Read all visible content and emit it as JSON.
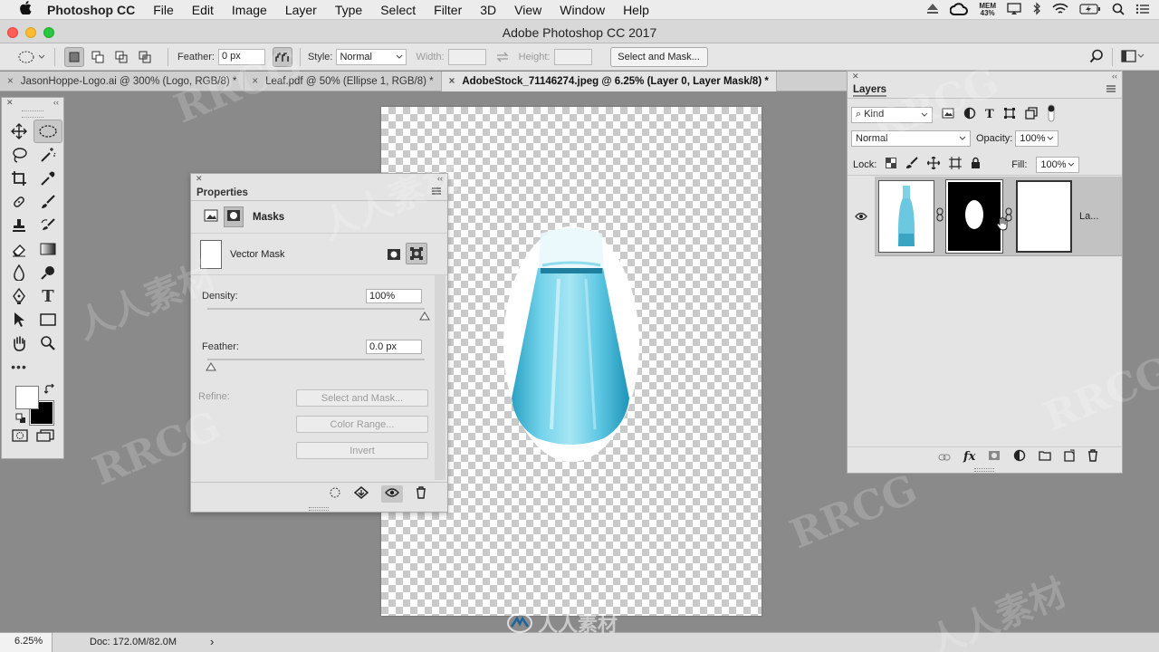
{
  "menubar": {
    "app_name": "Photoshop CC",
    "items": [
      "File",
      "Edit",
      "Image",
      "Layer",
      "Type",
      "Select",
      "Filter",
      "3D",
      "View",
      "Window",
      "Help"
    ],
    "mem_label": "MEM",
    "mem_value": "43%"
  },
  "window": {
    "title": "Adobe Photoshop CC 2017"
  },
  "options": {
    "feather_label": "Feather:",
    "feather_value": "0 px",
    "style_label": "Style:",
    "style_value": "Normal",
    "width_label": "Width:",
    "height_label": "Height:",
    "select_mask_button": "Select and Mask..."
  },
  "tabs": [
    {
      "label": "JasonHoppe-Logo.ai @ 300% (Logo, RGB/8) *"
    },
    {
      "label": "Leaf.pdf @ 50% (Ellipse 1, RGB/8) *"
    },
    {
      "label": "AdobeStock_71146274.jpeg @ 6.25% (Layer 0, Layer Mask/8) *"
    }
  ],
  "properties": {
    "panel_title": "Properties",
    "section": "Masks",
    "mask_type": "Vector Mask",
    "density_label": "Density:",
    "density_value": "100%",
    "density_fraction": 1.0,
    "feather_label": "Feather:",
    "feather_value": "0.0 px",
    "feather_fraction": 0.0,
    "refine_label": "Refine:",
    "buttons": {
      "select_mask": "Select and Mask...",
      "color_range": "Color Range...",
      "invert": "Invert"
    }
  },
  "layers": {
    "panel_title": "Layers",
    "filter_value": "Kind",
    "blend_mode": "Normal",
    "opacity_label": "Opacity:",
    "opacity_value": "100%",
    "lock_label": "Lock:",
    "fill_label": "Fill:",
    "fill_value": "100%",
    "layer_name": "La..."
  },
  "statusbar": {
    "zoom": "6.25%",
    "doc_info": "Doc: 172.0M/82.0M"
  },
  "watermark": {
    "text": "RRCG",
    "cjk": "人人素材",
    "logo_text": "人人素材"
  },
  "colors": {
    "accent_glass": "#67c7de",
    "mask_black": "#000000",
    "panel_bg": "#e4e4e4"
  }
}
